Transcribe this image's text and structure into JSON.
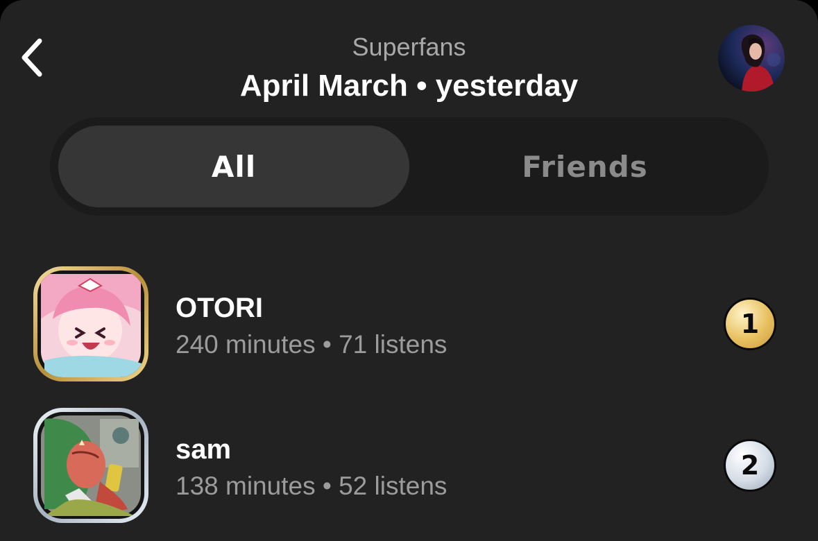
{
  "header": {
    "subtitle": "Superfans",
    "title": "April March • yesterday"
  },
  "tabs": [
    {
      "label": "All",
      "selected": true
    },
    {
      "label": "Friends",
      "selected": false
    }
  ],
  "fans": [
    {
      "name": "OTORI",
      "stats": "240 minutes • 71 listens",
      "rank": "1",
      "tier": "gold"
    },
    {
      "name": "sam",
      "stats": "138 minutes • 52 listens",
      "rank": "2",
      "tier": "silver"
    }
  ],
  "colors": {
    "background": "#222222",
    "gold": "#e8c060",
    "silver": "#d4dce6",
    "text_secondary": "#9c9c9c"
  },
  "icons": {
    "back": "chevron-left-icon"
  }
}
